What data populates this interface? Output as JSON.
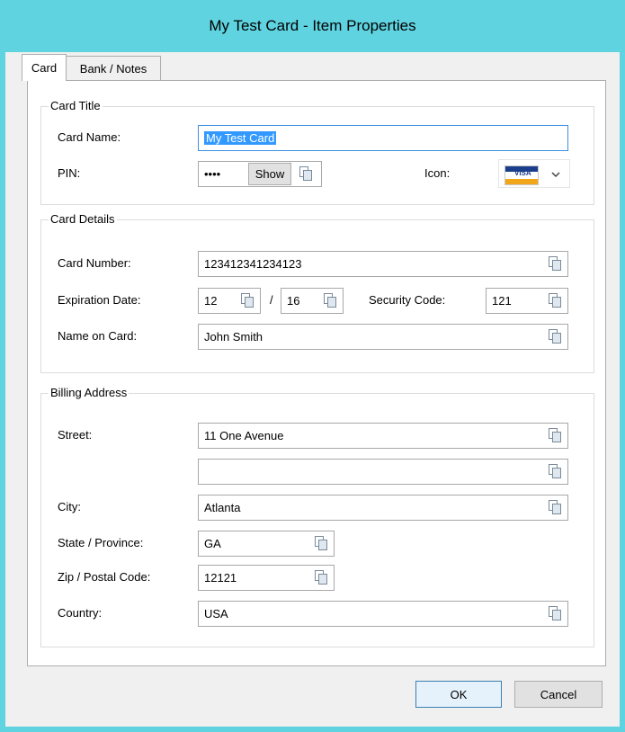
{
  "window": {
    "title": "My Test Card - Item Properties"
  },
  "tabs": [
    {
      "label": "Card"
    },
    {
      "label": "Bank / Notes"
    }
  ],
  "card_title": {
    "group_label": "Card Title",
    "name_label": "Card Name:",
    "name_value": "My Test Card",
    "pin_label": "PIN:",
    "pin_value": "••••",
    "show_label": "Show",
    "icon_label": "Icon:",
    "icon_selected": "credit-card-visa-icon",
    "icon_text": "VISA"
  },
  "card_details": {
    "group_label": "Card Details",
    "number_label": "Card Number:",
    "number_value": "123412341234123",
    "expiration_label": "Expiration Date:",
    "exp_month": "12",
    "exp_separator": "/",
    "exp_year": "16",
    "security_label": "Security Code:",
    "security_value": "121",
    "name_on_card_label": "Name on Card:",
    "name_on_card_value": "John Smith"
  },
  "billing": {
    "group_label": "Billing Address",
    "street_label": "Street:",
    "street1": "11 One Avenue",
    "street2": "",
    "city_label": "City:",
    "city": "Atlanta",
    "state_label": "State / Province:",
    "state": "GA",
    "zip_label": "Zip / Postal Code:",
    "zip": "12121",
    "country_label": "Country:",
    "country": "USA"
  },
  "buttons": {
    "ok": "OK",
    "cancel": "Cancel"
  },
  "colors": {
    "titlebar": "#5fd3e0",
    "focus_border": "#3d8fe0",
    "selection": "#3399ff"
  }
}
